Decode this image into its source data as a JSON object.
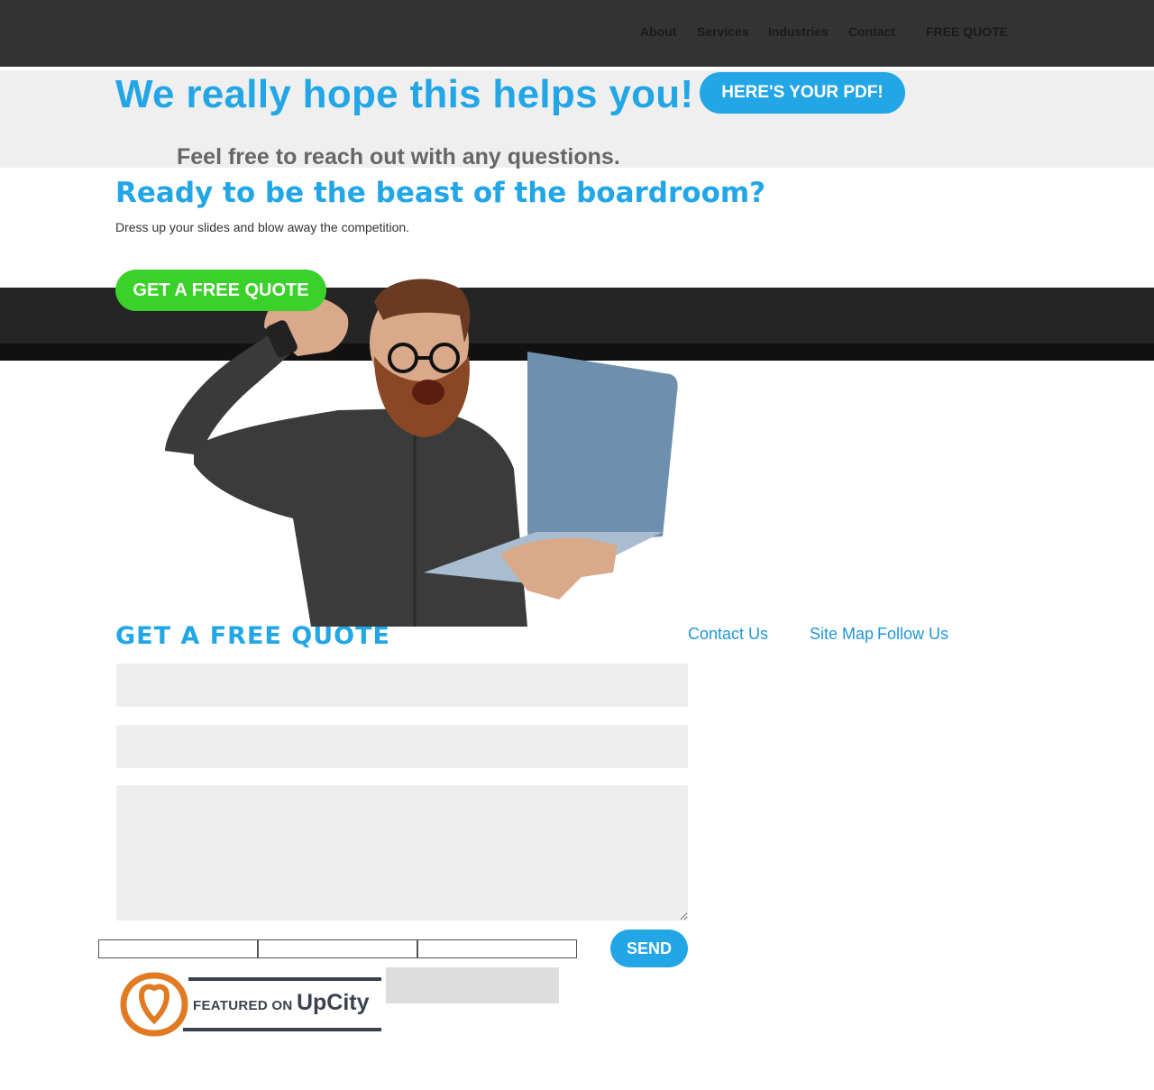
{
  "nav": {
    "about": "About",
    "services": "Services",
    "industries": "Industries",
    "contact": "Contact",
    "free_quote": "FREE QUOTE"
  },
  "hero": {
    "title": "We really hope this helps you!",
    "pdf_button": "HERE'S YOUR PDF!",
    "subtitle": "Feel free to reach out with any questions."
  },
  "cta": {
    "title": "Ready to be the beast of the boardroom?",
    "subtitle": "Dress up your slides and blow away the competition.",
    "button": "GET A FREE QUOTE"
  },
  "footer": {
    "form_title": "GET A FREE QUOTE",
    "contact_us": "Contact Us",
    "site_map": "Site Map",
    "follow_us": "Follow Us",
    "send": "SEND"
  },
  "badge": {
    "featured": "FEATURED ON",
    "brand": "UpCity"
  },
  "colors": {
    "accent_blue": "#22a6e6",
    "cta_green": "#3ad12a",
    "header_dark": "#333333",
    "upcity_orange": "#e07b24"
  }
}
